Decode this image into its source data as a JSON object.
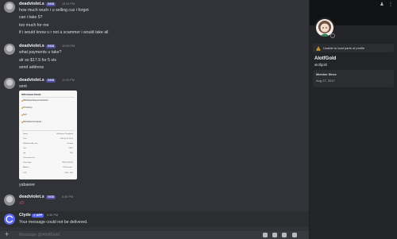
{
  "messages": [
    {
      "author": "deadviolet.s",
      "badge": "GOD",
      "time": "10:31 PM",
      "lines": [
        "how much wuch r u selling cuz i forgot",
        "can i take 5?",
        "too much for me",
        "if i would know u r not a scammer i would take all"
      ]
    },
    {
      "author": "deadviolet.s",
      "badge": "GOD",
      "time": "10:55 PM",
      "lines": [
        "what payments u take?",
        "alr so $17.5 for 5 stx",
        "send address"
      ]
    },
    {
      "author": "deadviolet.s",
      "badge": "GOD",
      "time": "11:09 PM",
      "lines": [
        "sent"
      ],
      "after_attachment": [
        "yabaeee"
      ]
    },
    {
      "author": "deadviolet.s",
      "badge": "GOD",
      "time": "5:36 PM",
      "lines": [
        "xD"
      ]
    }
  ],
  "attachment": {
    "title": "Withdrawal Details",
    "steps": [
      "Withdrawal Request Submitted",
      "Processing",
      "Sent",
      "Withdrawal Completed"
    ],
    "rows": [
      {
        "k": "Status",
        "v": "Withdrawal Completed"
      },
      {
        "k": "Time",
        "v": "2023-10-10 22:00"
      },
      {
        "k": "Withdrawal Account",
        "v": "Funding"
      },
      {
        "k": "Coin",
        "v": "USDT"
      },
      {
        "k": "Qty",
        "v": "20.0"
      },
      {
        "k": "Transaction Fee",
        "v": ""
      },
      {
        "k": "Chain Type",
        "v": "TRON (TRC20)"
      },
      {
        "k": "Address",
        "v": "TXhUmxrsd…"
      },
      {
        "k": "TxID",
        "v": "e3d1…fa01"
      }
    ]
  },
  "clyde": {
    "author": "Clyde",
    "badge": "✓ APP",
    "time": "5:36 PM",
    "text": "Your message could not be delivered."
  },
  "composer": {
    "placeholder": "Message @AlotfGold"
  },
  "profile": {
    "warning": "Unable to load parts of profile",
    "display_name": "AlotfGold",
    "username": "alotfgold",
    "member_since_label": "Member Since",
    "member_since": "Aug 27, 2017"
  },
  "colors": {
    "accent": "#5865f2",
    "danger": "#f23f42",
    "warning": "#f0b232"
  },
  "icons": [
    "plus-circle-icon",
    "gift-icon",
    "gif-icon",
    "sticker-icon",
    "emoji-icon",
    "add-friend-icon",
    "more-icon",
    "warning-icon",
    "verified-icon"
  ]
}
